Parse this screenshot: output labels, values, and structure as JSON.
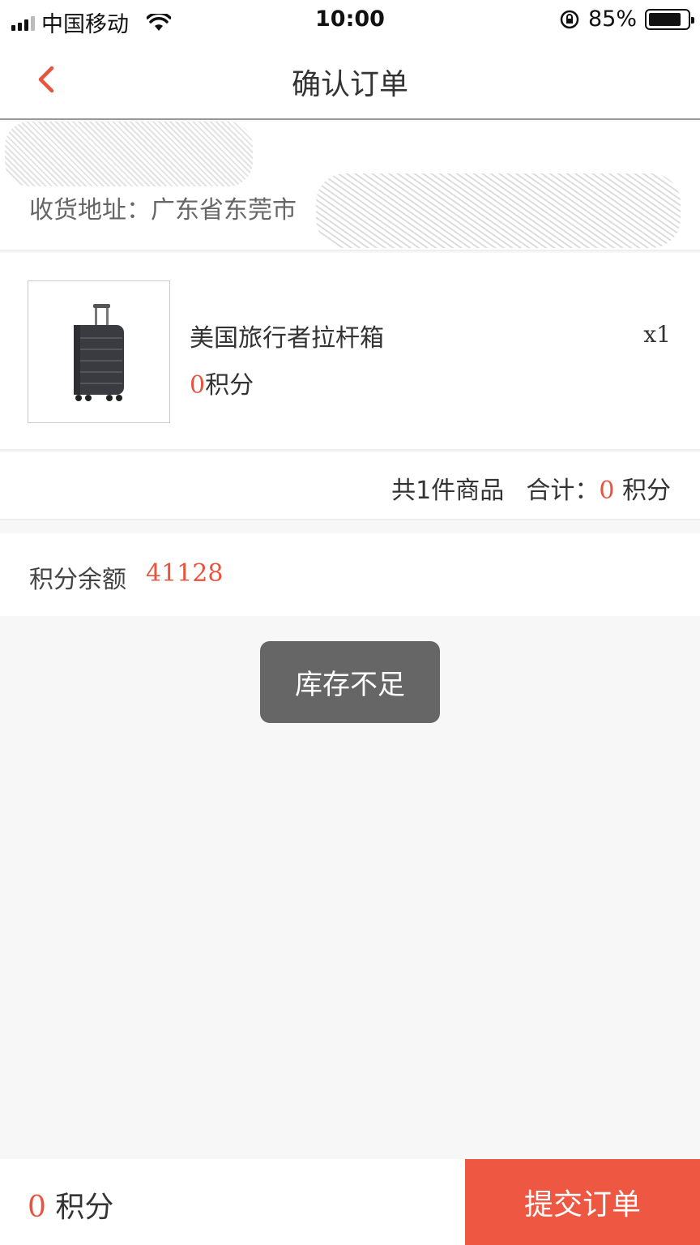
{
  "status_bar": {
    "carrier": "中国移动",
    "time": "10:00",
    "battery": "85%",
    "battery_level": 0.85
  },
  "nav": {
    "title": "确认订单",
    "back_icon": "chevron-left-icon"
  },
  "address": {
    "label": "收货地址：",
    "city": "广东省东莞市"
  },
  "product": {
    "name": "美国旅行者拉杆箱",
    "price_value": "0",
    "price_unit": "积分",
    "quantity": "x1"
  },
  "summary": {
    "count_text": "共1件商品",
    "total_label": "合计：",
    "total_value": "0",
    "total_unit": "积分"
  },
  "balance": {
    "label": "积分余额",
    "value": "41128"
  },
  "toast": {
    "message": "库存不足"
  },
  "bottom": {
    "total_value": "0",
    "total_unit": "积分",
    "submit_label": "提交订单"
  },
  "colors": {
    "accent": "#e8553f",
    "submit_bg": "#ee5843",
    "toast_bg": "#666666"
  }
}
